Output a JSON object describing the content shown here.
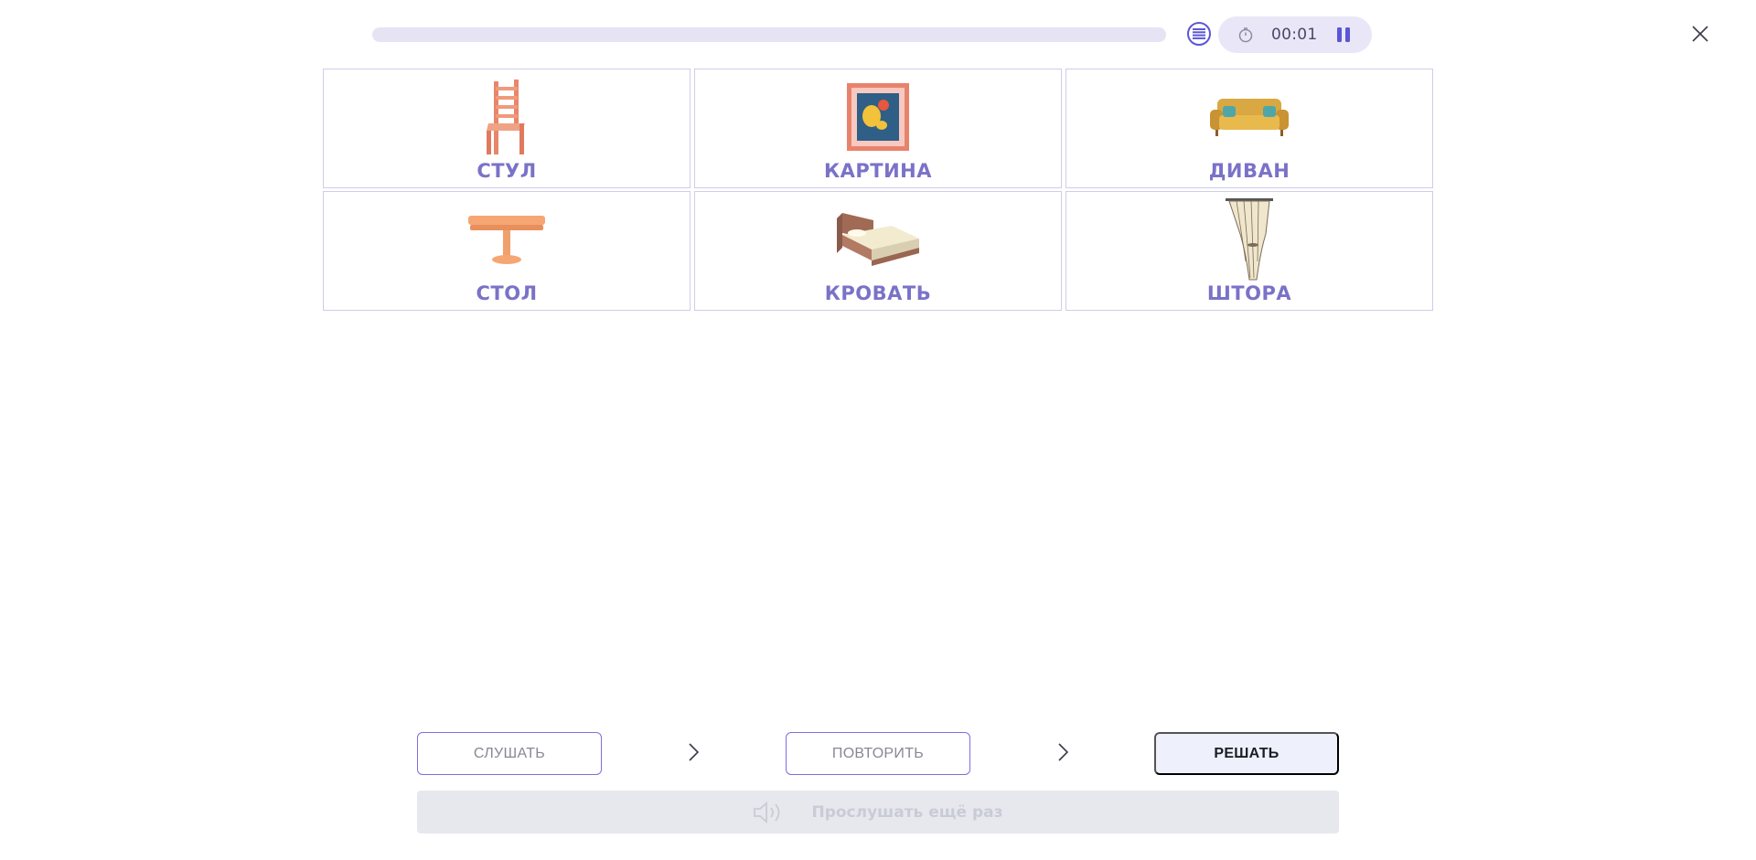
{
  "header": {
    "progress": 0,
    "timer": "00:01",
    "icons": {
      "list": "list-icon",
      "stopwatch": "stopwatch-icon",
      "pause": "pause-icon",
      "close": "close-icon"
    }
  },
  "cards": [
    {
      "word": "СТУЛ",
      "icon": "chair-image"
    },
    {
      "word": "КАРТИНА",
      "icon": "picture-image"
    },
    {
      "word": "ДИВАН",
      "icon": "sofa-image"
    },
    {
      "word": "СТОЛ",
      "icon": "table-image"
    },
    {
      "word": "КРОВАТЬ",
      "icon": "bed-image"
    },
    {
      "word": "ШТОРА",
      "icon": "curtain-image"
    }
  ],
  "steps": {
    "listen_label": "СЛУШАТЬ",
    "repeat_label": "ПОВТОРИТЬ",
    "solve_label": "РЕШАТЬ"
  },
  "replay": {
    "label": "Прослушать ещё раз"
  },
  "colors": {
    "accent": "#5b56d6",
    "card_text": "#7a72c8",
    "card_border": "#cfcdea",
    "progress_track": "#e5e3f4"
  }
}
